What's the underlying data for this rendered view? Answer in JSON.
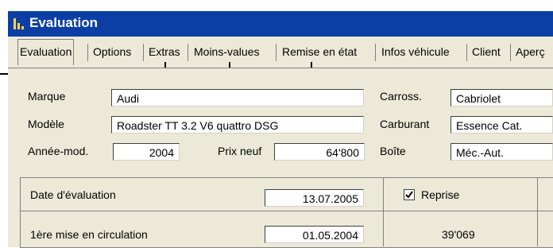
{
  "window": {
    "title": "Evaluation"
  },
  "tabs": [
    "Evaluation",
    "Options",
    "Extras",
    "Moins-values",
    "Remise en état",
    "Infos véhicule",
    "Client",
    "Aperç"
  ],
  "vehicle": {
    "marque_label": "Marque",
    "marque_value": "Audi",
    "modele_label": "Modèle",
    "modele_value": "Roadster TT 3.2 V6 quattro DSG",
    "annee_label": "Année-mod.",
    "annee_value": "2004",
    "prix_label": "Prix neuf",
    "prix_value": "64'800",
    "carross_label": "Carross.",
    "carross_value": "Cabriolet",
    "carburant_label": "Carburant",
    "carburant_value": "Essence Cat.",
    "boite_label": "Boîte",
    "boite_value": "Méc.-Aut."
  },
  "evaluation": {
    "date_label": "Date d'évaluation",
    "date_value": "13.07.2005",
    "reprise_label": "Reprise",
    "reprise_checked": true,
    "first_reg_label": "1ère mise en circulation",
    "first_reg_value": "01.05.2004",
    "km_value": "39'069"
  },
  "colors": {
    "titlebar": "#0b3fa5",
    "panel": "#ece9d8"
  }
}
